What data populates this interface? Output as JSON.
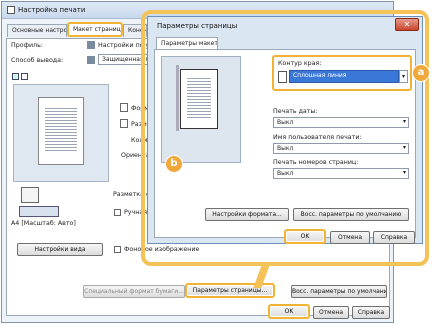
{
  "main_window": {
    "title": "Настройка печати",
    "tabs": [
      "Основные настройки",
      "Макет страницы",
      "Конечная обработка"
    ],
    "profile_label": "Профиль:",
    "profile_value": "Настройки по умолчанию",
    "output_label": "Способ вывода:",
    "output_value": "Защищенная печать",
    "format_label": "Формат",
    "size_label": "Размер",
    "copies_label": "Количество",
    "orientation_label": "Ориентация",
    "layout_label": "Разметка страницы",
    "manual_label": "Ручная настройка",
    "background_label": "Фоновое изображение",
    "preview_caption": "A4 [Масштаб: Авто]",
    "view_settings_button": "Настройки вида",
    "special_format_button": "Специальный формат бумаги...",
    "page_params_button": "Параметры страницы...",
    "restore_defaults_button": "Восс. параметры по умолчанию",
    "ok_button": "OK",
    "cancel_button": "Отмена",
    "help_button": "Справка"
  },
  "dialog": {
    "title": "Параметры страницы",
    "tab": "Параметры макета",
    "border_label": "Контур края:",
    "border_value": "Сплошная линия",
    "date_label": "Печать даты:",
    "date_value": "Выкл",
    "user_label": "Имя пользователя печати:",
    "user_value": "Выкл",
    "page_numbers_label": "Печать номеров страниц:",
    "page_numbers_value": "Выкл",
    "format_settings_button": "Настройки формата...",
    "restore_defaults_button": "Восс. параметры по умолчанию",
    "ok_button": "OK",
    "cancel_button": "Отмена",
    "help_button": "Справка"
  },
  "badges": {
    "a": "a",
    "b": "b"
  },
  "colors": {
    "highlight": "#f2b233",
    "selected_option": "#3a78d8"
  }
}
